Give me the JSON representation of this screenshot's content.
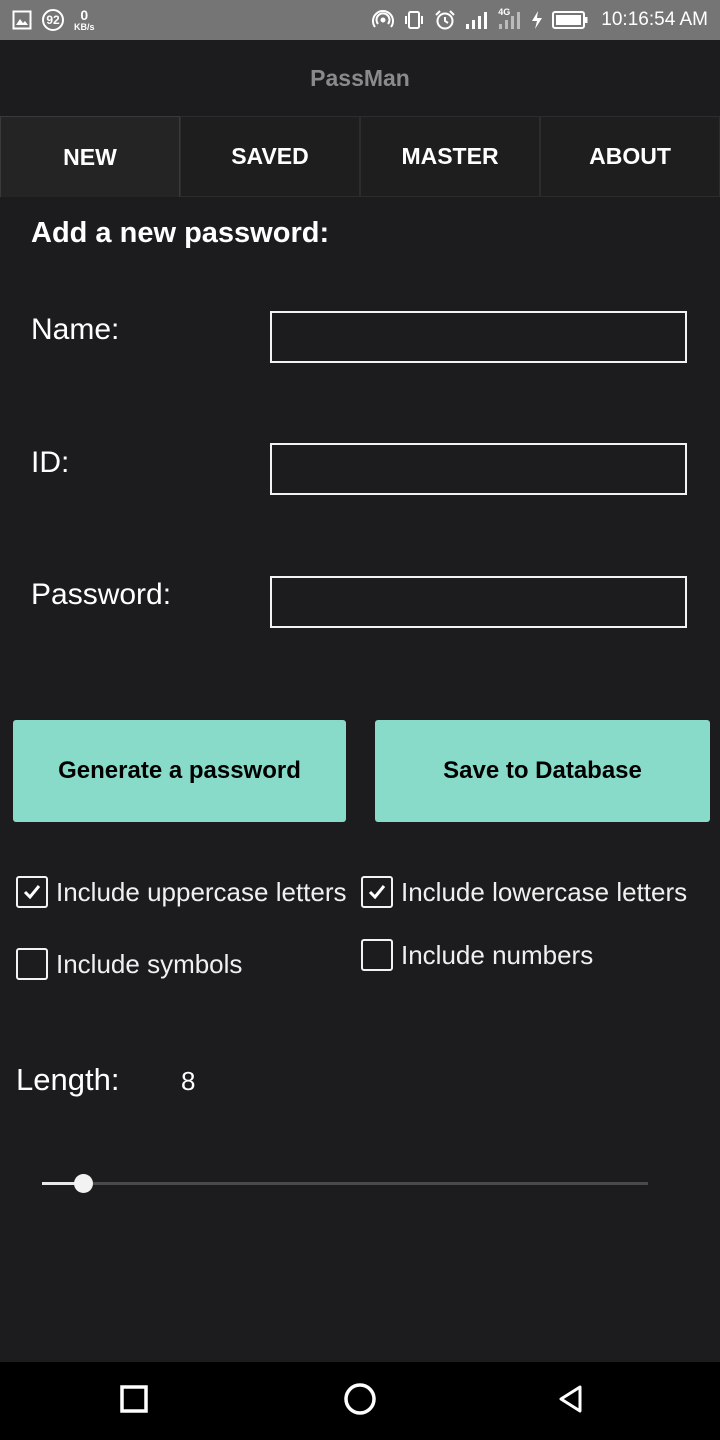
{
  "status_bar": {
    "notification_count": "92",
    "speed_value": "0",
    "speed_unit": "KB/s",
    "network_label": "4G",
    "time": "10:16:54 AM"
  },
  "app": {
    "title": "PassMan"
  },
  "tabs": [
    {
      "label": "NEW",
      "active": true
    },
    {
      "label": "SAVED",
      "active": false
    },
    {
      "label": "MASTER",
      "active": false
    },
    {
      "label": "ABOUT",
      "active": false
    }
  ],
  "form": {
    "heading": "Add a new password:",
    "fields": [
      {
        "label": "Name:",
        "value": ""
      },
      {
        "label": "ID:",
        "value": ""
      },
      {
        "label": "Password:",
        "value": ""
      }
    ]
  },
  "buttons": {
    "generate": "Generate a password",
    "save": "Save to Database"
  },
  "options": [
    {
      "label": "Include uppercase letters",
      "checked": true
    },
    {
      "label": "Include lowercase letters",
      "checked": true
    },
    {
      "label": "Include symbols",
      "checked": false
    },
    {
      "label": "Include numbers",
      "checked": false
    }
  ],
  "length": {
    "label": "Length:",
    "value": "8",
    "slider_fraction": 0.068
  },
  "colors": {
    "background": "#1c1c1e",
    "accent": "#88dbc8",
    "status_bar": "#757575"
  },
  "nav": {
    "recents_icon": "square-icon",
    "home_icon": "circle-icon",
    "back_icon": "triangle-back-icon"
  }
}
